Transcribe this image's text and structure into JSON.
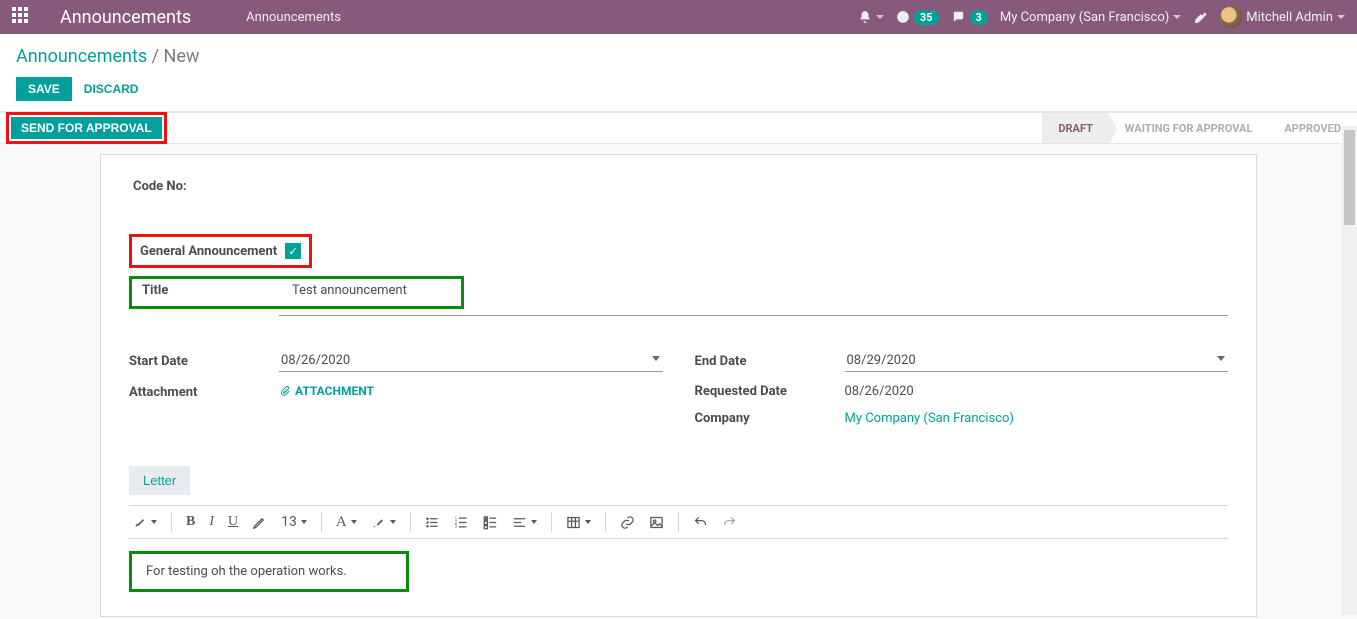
{
  "header": {
    "app_title": "Announcements",
    "menu1": "Announcements",
    "notif_count": "35",
    "chat_count": "3",
    "company": "My Company (San Francisco)",
    "user": "Mitchell Admin"
  },
  "breadcrumb": {
    "root": "Announcements",
    "sep": " / ",
    "current": "New"
  },
  "buttons": {
    "save": "SAVE",
    "discard": "DISCARD",
    "send_approval": "SEND FOR APPROVAL"
  },
  "status": {
    "s1": "DRAFT",
    "s2": "WAITING FOR APPROVAL",
    "s3": "APPROVED"
  },
  "form": {
    "code_label": "Code No:",
    "general_label": "General Announcement",
    "general_checked": true,
    "title_label": "Title",
    "title_value": "Test announcement",
    "start_date_label": "Start Date",
    "start_date_value": "08/26/2020",
    "attachment_label": "Attachment",
    "attachment_link": "ATTACHMENT",
    "end_date_label": "End Date",
    "end_date_value": "08/29/2020",
    "requested_date_label": "Requested Date",
    "requested_date_value": "08/26/2020",
    "company_label": "Company",
    "company_value": "My Company (San Francisco)"
  },
  "tabs": {
    "letter": "Letter"
  },
  "toolbar": {
    "font_size": "13",
    "font_label": "A"
  },
  "editor": {
    "content": "For testing oh the operation works."
  }
}
